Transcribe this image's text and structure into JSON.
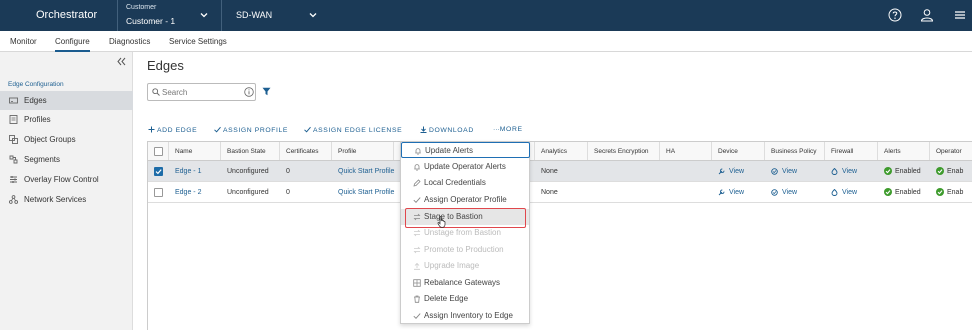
{
  "topbar": {
    "app_name": "Orchestrator",
    "customer_label": "Customer",
    "customer_value": "Customer - 1",
    "product": "SD-WAN"
  },
  "nav": {
    "tabs": [
      "Monitor",
      "Configure",
      "Diagnostics",
      "Service Settings"
    ],
    "active": "Configure"
  },
  "sidebar": {
    "section_title": "Edge Configuration",
    "items": [
      {
        "label": "Edges",
        "icon": "edge-icon",
        "active": true
      },
      {
        "label": "Profiles",
        "icon": "profile-icon"
      },
      {
        "label": "Object Groups",
        "icon": "object-groups-icon"
      },
      {
        "label": "Segments",
        "icon": "segments-icon"
      },
      {
        "label": "Overlay Flow Control",
        "icon": "flow-control-icon"
      },
      {
        "label": "Network Services",
        "icon": "network-services-icon"
      }
    ]
  },
  "main": {
    "title": "Edges",
    "search_placeholder": "Search",
    "actions": [
      "ADD EDGE",
      "ASSIGN PROFILE",
      "ASSIGN EDGE LICENSE",
      "DOWNLOAD",
      "MORE"
    ]
  },
  "table": {
    "columns": [
      "Name",
      "Bastion State",
      "Certificates",
      "Profile",
      "",
      "Analytics",
      "Secrets Encryption",
      "HA",
      "Device",
      "Business Policy",
      "Firewall",
      "Alerts",
      "Operator"
    ],
    "rows": [
      {
        "selected": true,
        "name": "Edge - 1",
        "bastion_state": "Unconfigured",
        "certificates": "0",
        "profile": "Quick Start Profile",
        "analytics": "None",
        "device": "View",
        "business_policy": "View",
        "firewall": "View",
        "alerts": "Enabled",
        "operator": "Enab"
      },
      {
        "selected": false,
        "name": "Edge - 2",
        "bastion_state": "Unconfigured",
        "certificates": "0",
        "profile": "Quick Start Profile",
        "analytics": "None",
        "device": "View",
        "business_policy": "View",
        "firewall": "View",
        "alerts": "Enabled",
        "operator": "Enab"
      }
    ]
  },
  "menu": {
    "items": [
      {
        "label": "Update Alerts",
        "icon": "bell-icon",
        "state": "focused"
      },
      {
        "label": "Update Operator Alerts",
        "icon": "bell-icon",
        "state": "normal"
      },
      {
        "label": "Local Credentials",
        "icon": "pencil-icon",
        "state": "normal"
      },
      {
        "label": "Assign Operator Profile",
        "icon": "check-icon",
        "state": "normal"
      },
      {
        "label": "Stage to Bastion",
        "icon": "swap-icon",
        "state": "hover"
      },
      {
        "label": "Unstage from Bastion",
        "icon": "swap-icon",
        "state": "disabled"
      },
      {
        "label": "Promote to Production",
        "icon": "swap-icon",
        "state": "disabled"
      },
      {
        "label": "Upgrade Image",
        "icon": "upload-icon",
        "state": "disabled"
      },
      {
        "label": "Rebalance Gateways",
        "icon": "grid-icon",
        "state": "normal"
      },
      {
        "label": "Delete Edge",
        "icon": "trash-icon",
        "state": "normal"
      },
      {
        "label": "Assign Inventory to Edge",
        "icon": "check-icon",
        "state": "normal"
      }
    ]
  },
  "colors": {
    "topbar_bg": "#1b3a57",
    "accent_link": "#1d5f91",
    "status_green": "#3e9b2d",
    "highlight_red": "#e0474c"
  }
}
